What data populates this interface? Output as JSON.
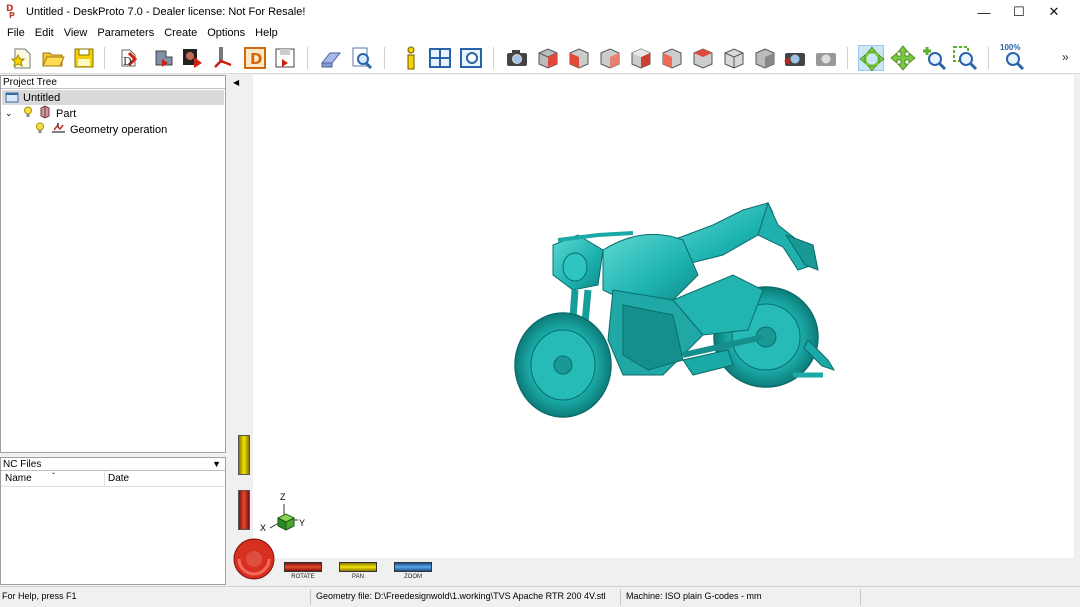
{
  "window": {
    "title": "Untitled - DeskProto 7.0 - Dealer license: Not For Resale!",
    "controls": {
      "minimize": "—",
      "maximize": "☐",
      "close": "✕"
    }
  },
  "menu": [
    "File",
    "Edit",
    "View",
    "Parameters",
    "Create",
    "Options",
    "Help"
  ],
  "toolbar": {
    "zoom_label": "100%",
    "more": "»"
  },
  "project_tree": {
    "header": "Project Tree",
    "items": [
      {
        "label": "Untitled",
        "icon": "project-icon"
      },
      {
        "label": "Part",
        "icon": "part-icon"
      },
      {
        "label": "Geometry operation",
        "icon": "geometry-operation-icon"
      }
    ]
  },
  "nc_files": {
    "header": "NC Files",
    "columns": [
      "Name",
      "Date"
    ]
  },
  "viewport": {
    "model": "motorcycle",
    "model_color": "#1bb6b3",
    "axes": {
      "x": "X",
      "y": "Y",
      "z": "Z"
    },
    "sliders": {
      "rotate": "ROTATE",
      "pan": "PAN",
      "zoom": "ZOOM"
    }
  },
  "status": {
    "help": "For Help, press F1",
    "geometry_file": "Geometry file: D:\\Freedesignwold\\1.working\\TVS Apache RTR 200 4V.stl",
    "machine": "Machine: ISO plain G-codes - mm"
  }
}
